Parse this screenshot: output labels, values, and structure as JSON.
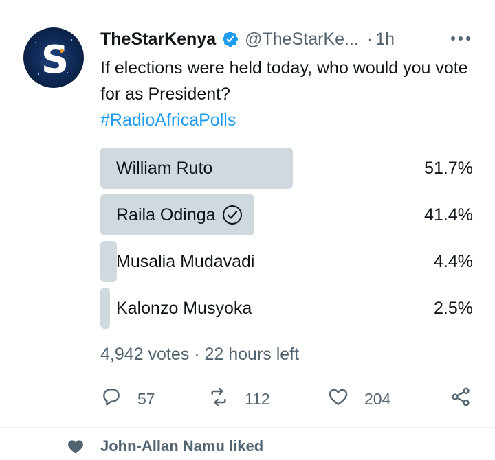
{
  "tweet": {
    "author_name": "TheStarKenya",
    "author_handle": "@TheStarKe...",
    "dot": "·",
    "time": "1h",
    "avatar_letter": "S",
    "avatar_small_text": "THE",
    "text": "If elections were held today, who would you vote for as President?",
    "hashtag": "#RadioAfricaPolls"
  },
  "poll": {
    "options": [
      {
        "label": "William Ruto",
        "percent_text": "51.7%",
        "fraction": 0.517,
        "selected": false
      },
      {
        "label": "Raila Odinga",
        "percent_text": "41.4%",
        "fraction": 0.414,
        "selected": true
      },
      {
        "label": "Musalia Mudavadi",
        "percent_text": "4.4%",
        "fraction": 0.044,
        "selected": false
      },
      {
        "label": "Kalonzo Musyoka",
        "percent_text": "2.5%",
        "fraction": 0.025,
        "selected": false
      }
    ],
    "meta": "4,942 votes · 22 hours left"
  },
  "actions": {
    "reply_count": "57",
    "retweet_count": "112",
    "like_count": "204"
  },
  "social_context": {
    "text": "John-Allan Namu liked"
  },
  "colors": {
    "accent": "#1d9bf0",
    "bar": "#cfd9de",
    "muted": "#536471",
    "text": "#0f1419"
  }
}
